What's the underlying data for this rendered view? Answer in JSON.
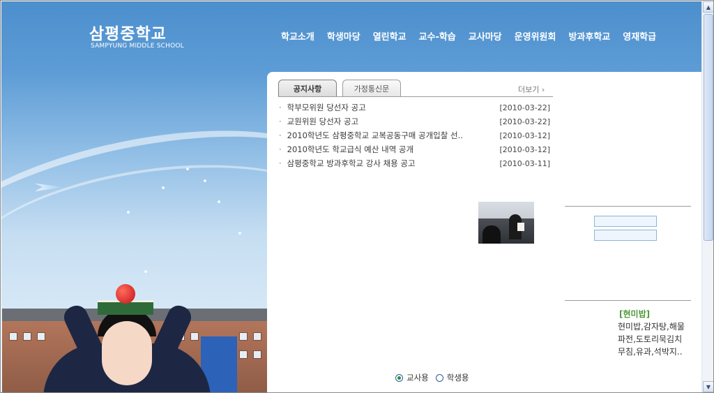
{
  "logo": {
    "korean": "삼평중학교",
    "english": "SAMPYUNG MIDDLE SCHOOL"
  },
  "nav": [
    "학교소개",
    "학생마당",
    "열린학교",
    "교수-학습",
    "교사마당",
    "운영위원회",
    "방과후학교",
    "영재학급"
  ],
  "board": {
    "tabs": [
      "공지사항",
      "가정통신문"
    ],
    "active_tab": 0,
    "more_label": "더보기 ›",
    "items": [
      {
        "title": "학부모위원 당선자 공고",
        "date": "[2010-03-22]"
      },
      {
        "title": "교원위원 당선자 공고",
        "date": "[2010-03-22]"
      },
      {
        "title": "2010학년도 삼평중학교 교복공동구매 공개입찰 선..",
        "date": "[2010-03-12]"
      },
      {
        "title": "2010학년도 학교급식 예산 내역 공개",
        "date": "[2010-03-12]"
      },
      {
        "title": "삼평중학교 방과후학교 강사 채용 공고",
        "date": "[2010-03-11]"
      }
    ]
  },
  "user_type": {
    "options": [
      "교사용",
      "학생용"
    ],
    "selected": 0
  },
  "meal": {
    "heading": "[현미밥]",
    "menu": "현미밥,감자탕,해물파전,도토리묵김치무침,유과,석박지.."
  },
  "colors": {
    "hero_blue": "#4c8fcd",
    "meal_green": "#4f9a3a"
  },
  "icons": {
    "scroll_up": "▲",
    "scroll_down": "▼"
  }
}
